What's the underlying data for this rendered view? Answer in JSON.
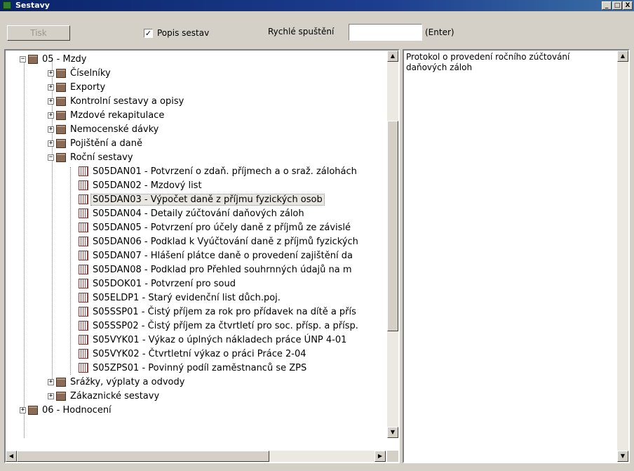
{
  "window": {
    "title": "Sestavy",
    "minimize": "_",
    "maximize": "□",
    "close": "X"
  },
  "toolbar": {
    "print_label": "Tisk",
    "show_desc_label": "Popis sestav",
    "show_desc_checked": "✓",
    "quick_run_label": "Rychlé spuštění",
    "quick_run_value": "",
    "enter_hint": "(Enter)"
  },
  "tree": {
    "root": "05 - Mzdy",
    "groups": [
      "Číselníky",
      "Exporty",
      "Kontrolní sestavy a opisy",
      "Mzdové rekapitulace",
      "Nemocenské dávky",
      "Pojištění a daně",
      "Roční sestavy"
    ],
    "reports": [
      "S05DAN01 - Potvrzení o zdaň. příjmech a o sraž. zálohách",
      "S05DAN02 - Mzdový list",
      "S05DAN03 - Výpočet daně z příjmu fyzických osob",
      "S05DAN04 - Detaily zúčtování daňových záloh",
      "S05DAN05 - Potvrzení pro účely daně z příjmů ze závislé",
      "S05DAN06 - Podklad k Vyúčtování daně z příjmů fyzických",
      "S05DAN07 - Hlášení plátce daně o provedení zajištění da",
      "S05DAN08 - Podklad pro Přehled souhrnných údajů na m",
      "S05DOK01 - Potvrzení pro soud",
      "S05ELDP1 - Starý evidenční list důch.poj.",
      "S05SSP01 - Čistý příjem za rok pro přídavek na dítě a přís",
      "S05SSP02 - Čistý příjem za čtvrtletí pro soc. přísp. a přísp.",
      "S05VYK01 - Výkaz o úplných nákladech práce ÚNP 4-01",
      "S05VYK02 - Čtvrtletní výkaz o práci Práce 2-04",
      "S05ZPS01 - Povinný podíl zaměstnanců se ZPS"
    ],
    "after_groups": [
      "Srážky, výplaty a odvody",
      "Zákaznické sestavy"
    ],
    "next_root": "06 - Hodnocení",
    "selected_report": "S05DAN03 - Výpočet daně z příjmu fyzických osob"
  },
  "description": {
    "text": "Protokol o provedení ročního zúčtování daňových záloh"
  },
  "scroll": {
    "up": "▲",
    "down": "▼",
    "left": "◀",
    "right": "▶"
  }
}
